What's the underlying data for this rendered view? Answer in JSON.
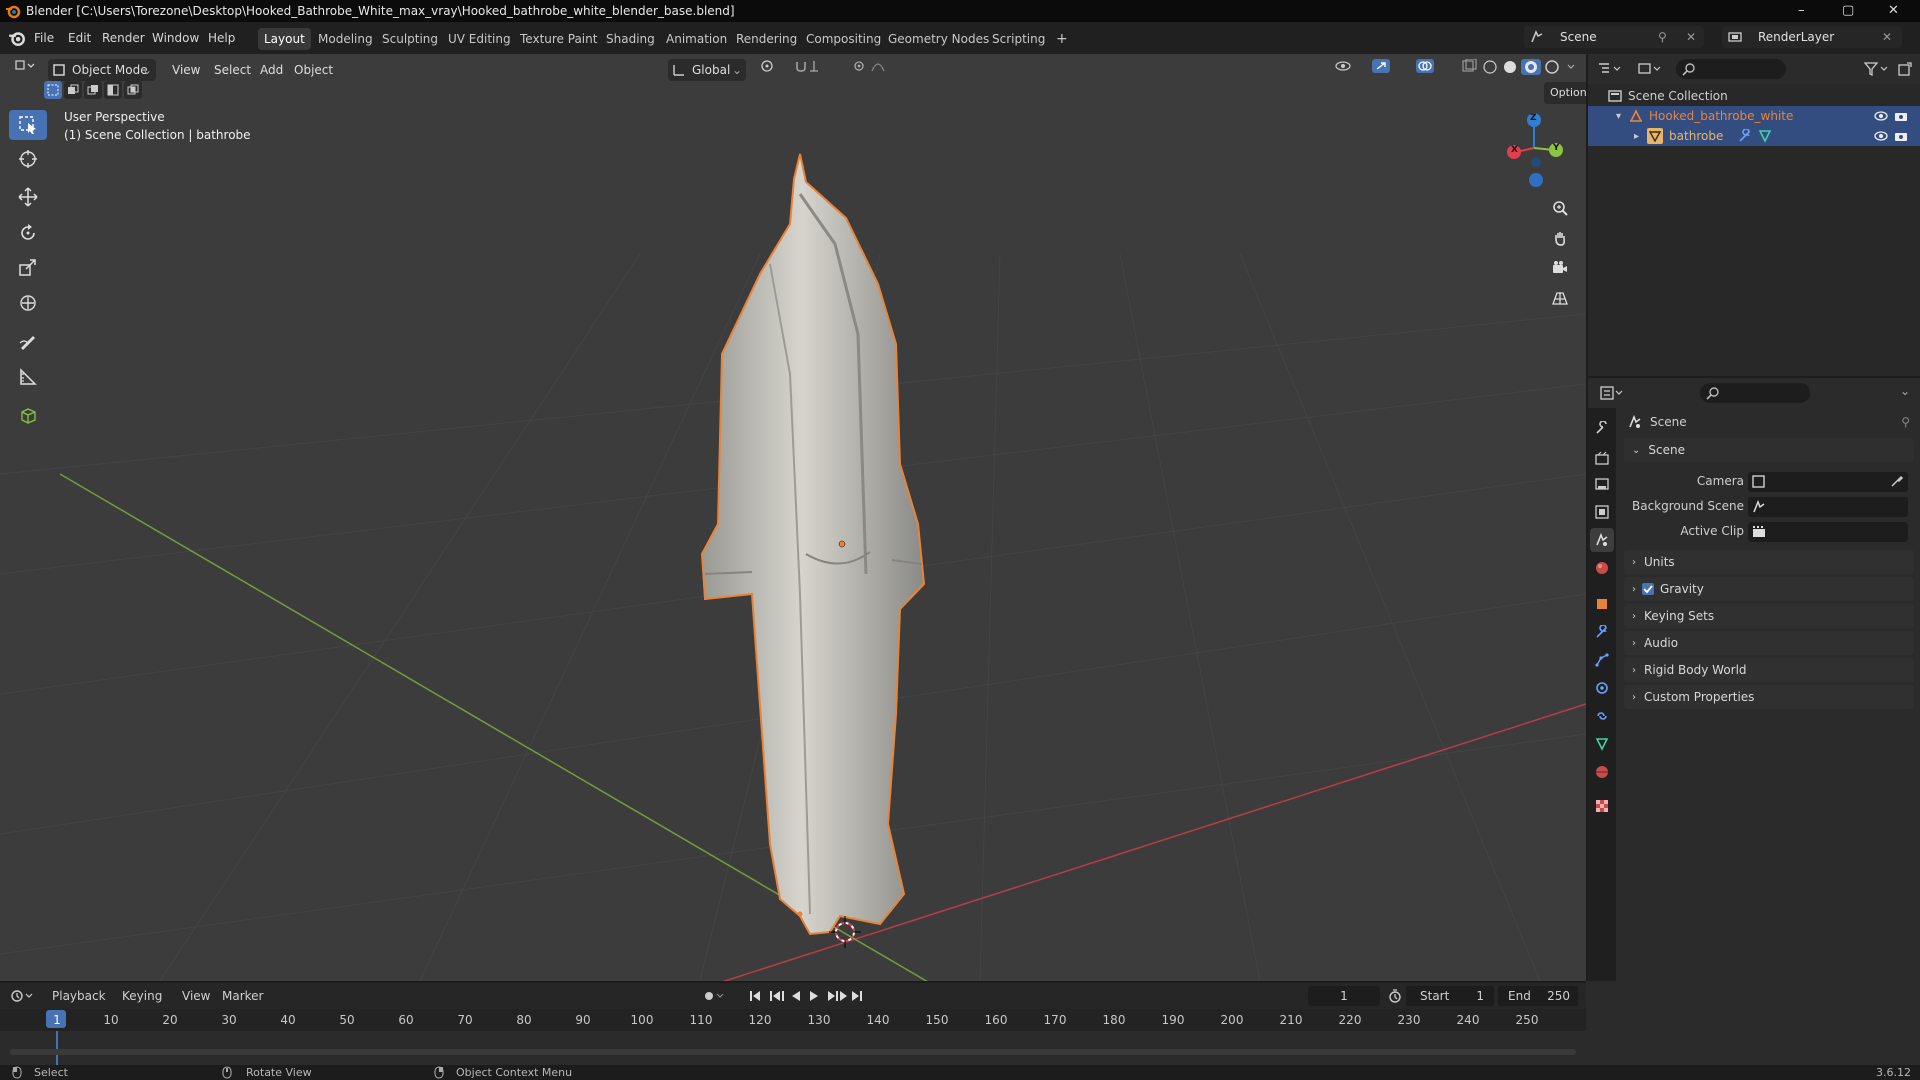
{
  "window": {
    "title": "Blender [C:\\Users\\Torezone\\Desktop\\Hooked_Bathrobe_White_max_vray\\Hooked_bathrobe_white_blender_base.blend]",
    "controls": {
      "minimize": "–",
      "maximize": "▢",
      "close": "✕"
    }
  },
  "menubar": {
    "menus": [
      "File",
      "Edit",
      "Render",
      "Window",
      "Help"
    ],
    "workspaces": [
      "Layout",
      "Modeling",
      "Sculpting",
      "UV Editing",
      "Texture Paint",
      "Shading",
      "Animation",
      "Rendering",
      "Compositing",
      "Geometry Nodes",
      "Scripting"
    ],
    "active_workspace": "Layout",
    "add_workspace": "+",
    "scene_name": "Scene",
    "render_layer": "RenderLayer"
  },
  "viewport": {
    "mode": "Object Mode",
    "menus": [
      "View",
      "Select",
      "Add",
      "Object"
    ],
    "transform_orientation": "Global",
    "options_label": "Options",
    "overlay_title": "User Perspective",
    "overlay_subtitle": "(1) Scene Collection | bathrobe",
    "gizmo": {
      "z": "Z",
      "y": "Y",
      "x": "X"
    }
  },
  "toolbar": {
    "tools": [
      "select-box",
      "cursor",
      "move",
      "rotate",
      "scale",
      "transform",
      "annotate",
      "measure",
      "add-cube"
    ],
    "active": "select-box"
  },
  "outliner": {
    "root": "Scene Collection",
    "items": [
      {
        "name": "Hooked_bathrobe_white",
        "color": "#e8843a"
      },
      {
        "name": "bathrobe",
        "color": "#e8b56a"
      }
    ]
  },
  "properties": {
    "context_title": "Scene",
    "section_scene": "Scene",
    "fields": [
      {
        "label": "Camera"
      },
      {
        "label": "Background Scene"
      },
      {
        "label": "Active Clip"
      }
    ],
    "panels": [
      "Units",
      "Gravity",
      "Keying Sets",
      "Audio",
      "Rigid Body World",
      "Custom Properties"
    ],
    "gravity_checked": true
  },
  "timeline": {
    "menus": [
      "Playback",
      "Keying",
      "View",
      "Marker"
    ],
    "current_frame": "1",
    "start_label": "Start",
    "start": "1",
    "end_label": "End",
    "end": "250",
    "ticks": [
      "1",
      "10",
      "20",
      "30",
      "40",
      "50",
      "60",
      "70",
      "80",
      "90",
      "100",
      "110",
      "120",
      "130",
      "140",
      "150",
      "160",
      "170",
      "180",
      "190",
      "200",
      "210",
      "220",
      "230",
      "240",
      "250"
    ]
  },
  "statusbar": {
    "select": "Select",
    "rotate": "Rotate View",
    "context": "Object Context Menu",
    "version": "3.6.12"
  },
  "colors": {
    "accent": "#4772b3",
    "selection_outline": "#e8843a",
    "x_axis": "#e33e4e",
    "y_axis": "#8bc53f",
    "z_axis": "#2f7fd6"
  }
}
